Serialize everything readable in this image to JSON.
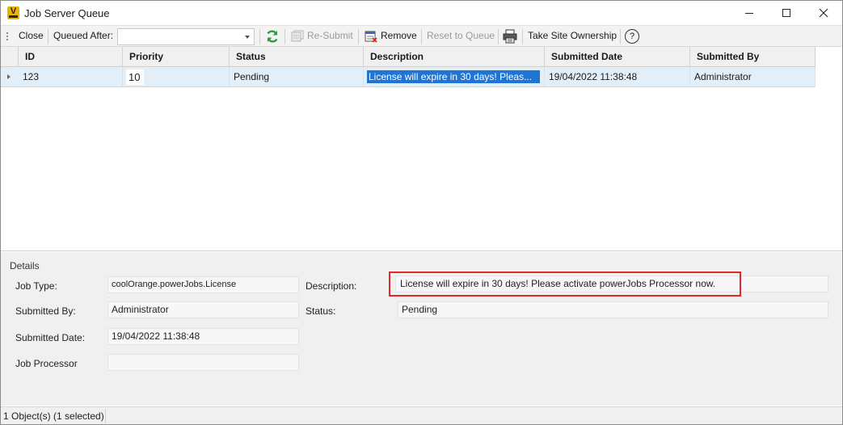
{
  "window": {
    "title": "Job Server Queue",
    "app_icon_letter": "V"
  },
  "toolbar": {
    "close_label": "Close",
    "queued_after_label": "Queued After:",
    "queued_after_value": "",
    "resubmit_label": "Re-Submit",
    "remove_label": "Remove",
    "reset_label": "Reset to Queue",
    "take_ownership_label": "Take Site Ownership",
    "help_label": "?"
  },
  "grid": {
    "columns": [
      "ID",
      "Priority",
      "Status",
      "Description",
      "Submitted Date",
      "Submitted By"
    ],
    "rows": [
      {
        "id": "123",
        "priority": "10",
        "status": "Pending",
        "description": "License will expire in 30 days! Pleas...",
        "submitted_date": "19/04/2022 11:38:48",
        "submitted_by": "Administrator"
      }
    ]
  },
  "details": {
    "title": "Details",
    "job_type_label": "Job Type:",
    "job_type_value": "coolOrange.powerJobs.License",
    "submitted_by_label": "Submitted By:",
    "submitted_by_value": "Administrator",
    "submitted_date_label": "Submitted Date:",
    "submitted_date_value": "19/04/2022 11:38:48",
    "job_processor_label": "Job Processor",
    "job_processor_value": "",
    "description_label": "Description:",
    "description_value": "License will expire in 30 days! Please activate powerJobs Processor now.",
    "status_label": "Status:",
    "status_value": "Pending"
  },
  "statusbar": {
    "text": "1 Object(s) (1 selected)"
  },
  "colors": {
    "selection_blue": "#1f74d4",
    "row_highlight": "#e2eff9",
    "annotation_red": "#e02a2a",
    "refresh_green": "#2e9b3a",
    "app_icon_yellow": "#e8b400"
  }
}
